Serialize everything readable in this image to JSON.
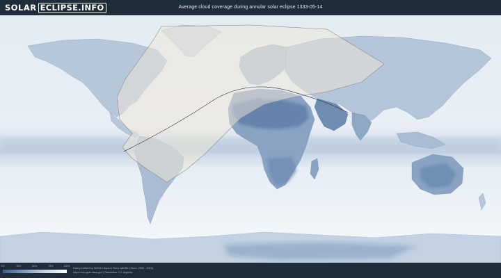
{
  "header": {
    "logo_part1": "SOLAR",
    "logo_part2": "ECLIPSE.INFO",
    "title": "Average cloud coverage during annular solar eclipse 1333-05-14"
  },
  "legend": {
    "labels": [
      "0%",
      "25%",
      "50%",
      "75%",
      "100%"
    ],
    "colors": [
      "#3d5f8c",
      "#7f9bbd",
      "#c8d6e5",
      "#ffffff"
    ]
  },
  "footer": {
    "credit_line1": "Data provided by NASA's Aqua & Terra satellite (Years: 2000 - 2019)",
    "credit_line2": "https://neo.gsfc.nasa.gov  |  Resolution: 0.1 degrees"
  },
  "map": {
    "ocean_color": "#dfe8f2",
    "land_cloud_low_color": "#6f8db3",
    "visibility_zone_color": "#efe6d6",
    "eclipse_path_color": "#3a4656"
  }
}
